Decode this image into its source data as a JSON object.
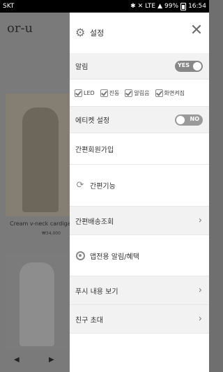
{
  "status_bar": {
    "carrier": "SKT",
    "battery": "99%",
    "time": "16:54",
    "network": "LTE"
  },
  "background_app": {
    "logo": "or-u",
    "product_caption": "Cream v-neck cardiga",
    "product_price": "₩34,000",
    "nav_prev": "◀",
    "nav_next": "▶"
  },
  "drawer": {
    "header_title": "설정",
    "close_label": "✕",
    "notification": {
      "label": "알림",
      "toggle": "YES",
      "enabled": true
    },
    "check_options": [
      {
        "label": "LED",
        "checked": true
      },
      {
        "label": "진동",
        "checked": true
      },
      {
        "label": "알림음",
        "checked": true
      },
      {
        "label": "화면켜짐",
        "checked": true
      }
    ],
    "etiquette": {
      "label": "에티켓 설정",
      "toggle": "NO",
      "enabled": false
    },
    "items": [
      "간편회원가입",
      "간편기능",
      "간편배송조회",
      "앱전용 알림/혜택",
      "푸시 내용 보기",
      "친구 초대"
    ]
  }
}
